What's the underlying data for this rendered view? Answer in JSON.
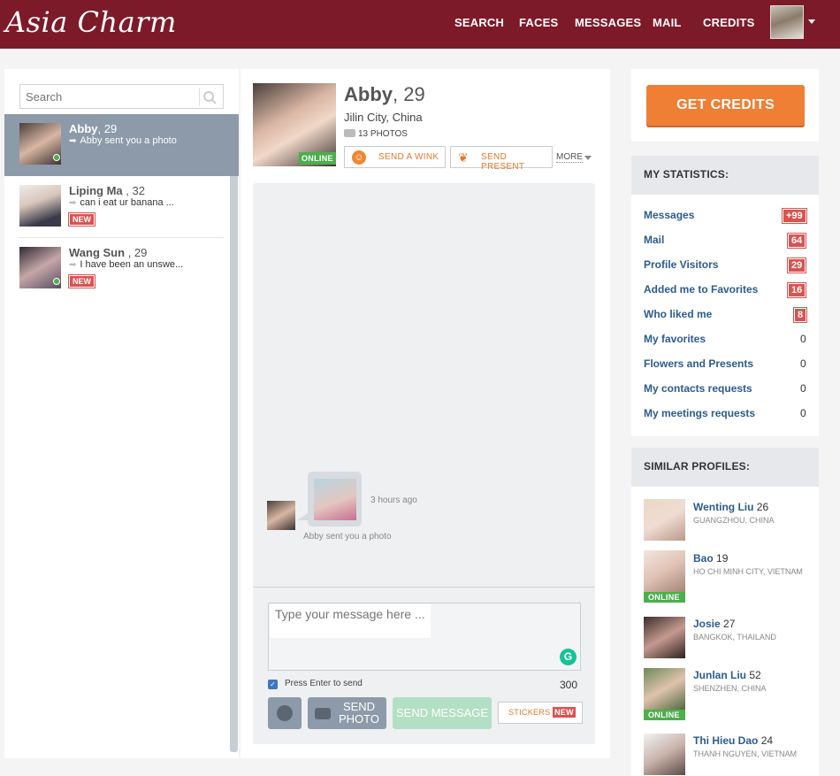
{
  "header": {
    "logo": "Asia Charm",
    "nav": [
      "SEARCH",
      "FACES",
      "MESSAGES",
      "MAIL",
      "CREDITS"
    ]
  },
  "conversations": {
    "search_placeholder": "Search",
    "items": [
      {
        "name": "Abby",
        "age": ", 29",
        "last": "Abby sent you a photo",
        "new": "",
        "online": true,
        "active": true
      },
      {
        "name": "Liping Ma",
        "age": " , 32",
        "last": "can i eat ur banana ...",
        "new": "NEW",
        "online": false,
        "active": false
      },
      {
        "name": "Wang Sun",
        "age": " , 29",
        "last": "I have been an unswe...",
        "new": "NEW",
        "online": true,
        "active": false
      }
    ]
  },
  "profile": {
    "name": "Abby",
    "age": ", 29",
    "location": "Jilin City, China",
    "photos": "13 PHOTOS",
    "online": "ONLINE",
    "wink": "SEND A WINK",
    "present": "SEND PRESENT",
    "more": "MORE"
  },
  "chat": {
    "time": "3 hours ago",
    "caption": "Abby sent you a photo"
  },
  "compose": {
    "placeholder": "Type your message here ...",
    "press_enter": "Press Enter to send",
    "char_count": "300",
    "send_photo": "SEND PHOTO",
    "send_message": "SEND MESSAGE",
    "stickers": "STICKERS",
    "stickers_new": "NEW"
  },
  "credits": {
    "button": "GET CREDITS"
  },
  "stats": {
    "title": "MY STATISTICS:",
    "items": [
      {
        "label": "Messages",
        "value": "+99",
        "badge": true
      },
      {
        "label": "Mail",
        "value": "64",
        "badge": true
      },
      {
        "label": "Profile Visitors",
        "value": "29",
        "badge": true
      },
      {
        "label": "Added me to Favorites",
        "value": "16",
        "badge": true
      },
      {
        "label": "Who liked me",
        "value": "8",
        "badge": true
      },
      {
        "label": "My favorites",
        "value": "0",
        "badge": false
      },
      {
        "label": "Flowers and Presents",
        "value": "0",
        "badge": false
      },
      {
        "label": "My contacts requests",
        "value": "0",
        "badge": false
      },
      {
        "label": "My meetings requests",
        "value": "0",
        "badge": false
      }
    ]
  },
  "similar": {
    "title": "SIMILAR PROFILES:",
    "online_label": "ONLINE",
    "items": [
      {
        "name": "Wenting Liu",
        "age": "26",
        "location": "GUANGZHOU, CHINA",
        "online": false
      },
      {
        "name": "Bao",
        "age": "19",
        "location": "HO CHI MINH CITY, VIETNAM",
        "online": true
      },
      {
        "name": "Josie",
        "age": "27",
        "location": "BANGKOK, THAILAND",
        "online": false
      },
      {
        "name": "Junlan Liu",
        "age": "52",
        "location": "SHENZHEN, CHINA",
        "online": true
      },
      {
        "name": "Thi Hieu Dao",
        "age": "24",
        "location": "THANH NGUYEN, VIETNAM",
        "online": false
      }
    ]
  }
}
